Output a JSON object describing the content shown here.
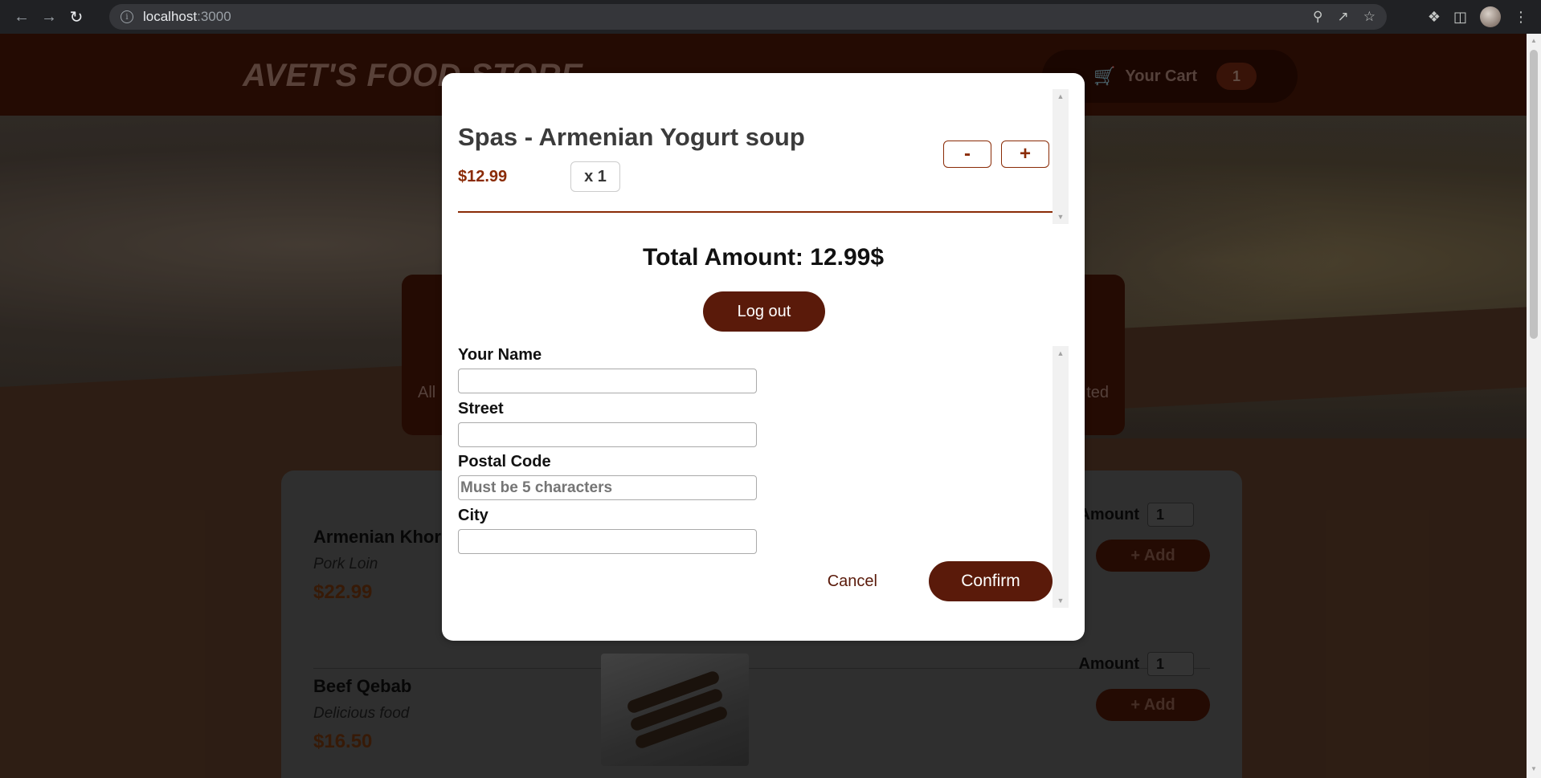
{
  "browser": {
    "url_host": "localhost",
    "url_port": ":3000"
  },
  "site": {
    "title": "AVET'S FOOD STORE",
    "cart_label": "Your Cart",
    "cart_count": "1",
    "summary_left": "All",
    "summary_right": "ted"
  },
  "meals": [
    {
      "name": "Armenian Khor",
      "description": "Pork Loin",
      "price": "$22.99",
      "amount_label": "Amount",
      "amount_value": "1",
      "add_label": "+ Add"
    },
    {
      "name": "Beef Qebab",
      "description": "Delicious food",
      "price": "$16.50",
      "amount_label": "Amount",
      "amount_value": "1",
      "add_label": "+ Add"
    }
  ],
  "modal": {
    "cart_item": {
      "name": "Spas - Armenian Yogurt soup",
      "price": "$12.99",
      "quantity": "x 1",
      "decrement_label": "-",
      "increment_label": "+"
    },
    "total_text": "Total Amount: 12.99$",
    "logout_label": "Log out",
    "form": {
      "name_label": "Your Name",
      "name_value": "",
      "street_label": "Street",
      "street_value": "",
      "postal_label": "Postal Code",
      "postal_value": "Must be 5 characters",
      "city_label": "City",
      "city_value": ""
    },
    "cancel_label": "Cancel",
    "confirm_label": "Confirm"
  },
  "colors": {
    "accent": "#5a1a0a",
    "price": "#8a2b06"
  }
}
